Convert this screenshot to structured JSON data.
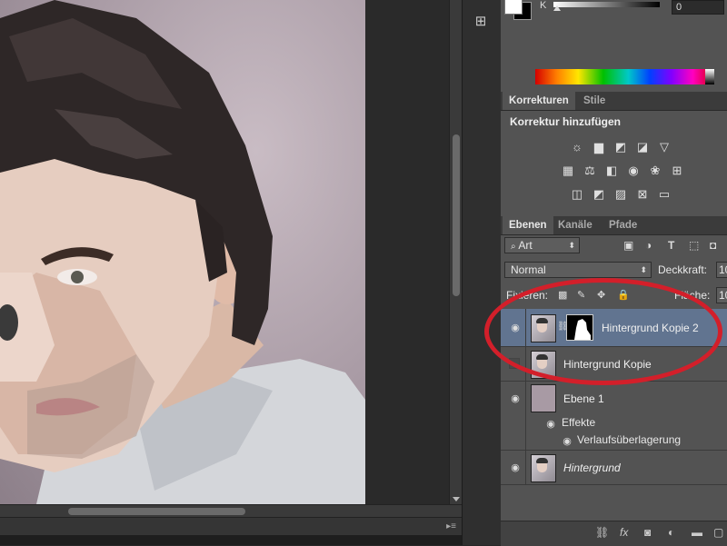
{
  "color_panel": {
    "channel_label": "K",
    "channel_value": "0",
    "k_slider_level": 0
  },
  "adjustments": {
    "tabs": [
      {
        "label": "Korrekturen",
        "active": true
      },
      {
        "label": "Stile",
        "active": false
      }
    ],
    "title": "Korrektur hinzufügen",
    "icons_row1": [
      "brightness-contrast-icon",
      "levels-icon",
      "curves-icon",
      "exposure-icon",
      "vibrance-icon"
    ],
    "icons_row2": [
      "hue-saturation-icon",
      "color-balance-icon",
      "black-white-icon",
      "photo-filter-icon",
      "channel-mixer-icon",
      "color-lookup-icon"
    ],
    "icons_row3": [
      "invert-icon",
      "posterize-icon",
      "threshold-icon",
      "selective-color-icon",
      "gradient-map-icon"
    ]
  },
  "layers_panel": {
    "tabs": [
      {
        "label": "Ebenen",
        "active": true
      },
      {
        "label": "Kanäle",
        "active": false
      },
      {
        "label": "Pfade",
        "active": false
      }
    ],
    "filter_kind": "Art",
    "blend_mode": "Normal",
    "opacity_label": "Deckkraft:",
    "opacity_value": "10",
    "lock_label": "Fixieren:",
    "fill_label": "Fläche:",
    "fill_value": "10",
    "layers": [
      {
        "name": "Hintergrund Kopie 2",
        "visible": true,
        "selected": true,
        "has_mask": true
      },
      {
        "name": "Hintergrund Kopie",
        "visible": false,
        "selected": false,
        "has_mask": false
      },
      {
        "name": "Ebene 1",
        "visible": true,
        "selected": false,
        "has_mask": false,
        "effects_label": "Effekte",
        "effect": "Verlaufsüberlagerung"
      },
      {
        "name": "Hintergrund",
        "visible": true,
        "selected": false,
        "has_mask": false,
        "italic": true
      }
    ]
  },
  "colors": {
    "selection_highlight": "#617490",
    "annotation_red": "#d31f2a",
    "panel_bg": "#535353"
  }
}
